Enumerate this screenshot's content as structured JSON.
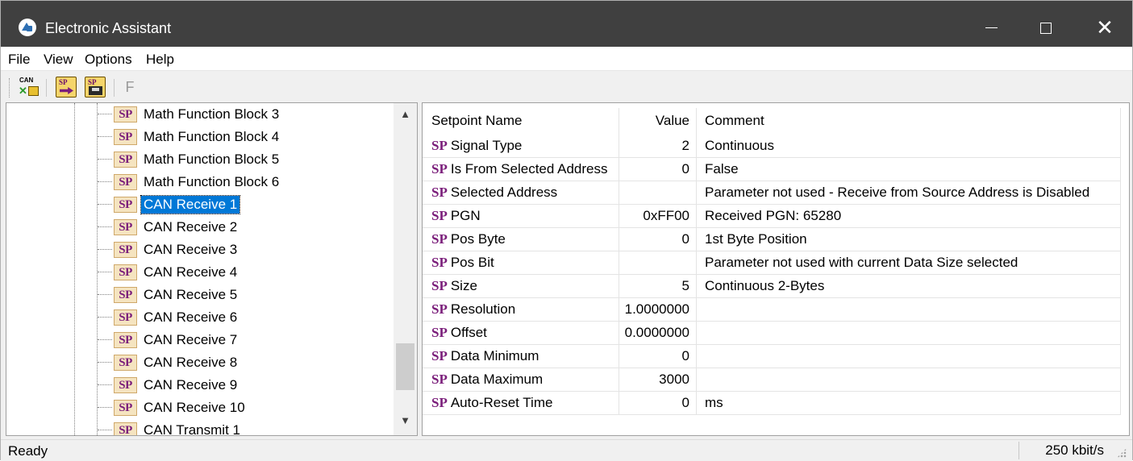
{
  "window": {
    "title": "Electronic Assistant",
    "icon": "electronic-assistant-logo"
  },
  "menu": [
    "File",
    "View",
    "Options",
    "Help"
  ],
  "toolbar": {
    "can_label": "CAN",
    "sp_label": "SP",
    "f_label": "F",
    "buttons": [
      "can-connect-icon",
      "open-setpoint-file-icon",
      "save-setpoint-file-icon",
      "flash-icon"
    ]
  },
  "tree": {
    "badge": "SP",
    "items": [
      "Math Function Block 3",
      "Math Function Block 4",
      "Math Function Block 5",
      "Math Function Block 6",
      "CAN Receive 1",
      "CAN Receive 2",
      "CAN Receive 3",
      "CAN Receive 4",
      "CAN Receive 5",
      "CAN Receive 6",
      "CAN Receive 7",
      "CAN Receive 8",
      "CAN Receive 9",
      "CAN Receive 10",
      "CAN Transmit 1"
    ],
    "selected": "CAN Receive 1"
  },
  "grid": {
    "headers": {
      "name": "Setpoint Name",
      "value": "Value",
      "comment": "Comment"
    },
    "tag": "SP",
    "rows": [
      {
        "name": "Signal Type",
        "value": "2",
        "comment": "Continuous"
      },
      {
        "name": "Is From Selected Address",
        "value": "0",
        "comment": "False"
      },
      {
        "name": "Selected Address",
        "value": "",
        "comment": "Parameter not used - Receive from Source Address is Disabled"
      },
      {
        "name": "PGN",
        "value": "0xFF00",
        "comment": "Received PGN: 65280"
      },
      {
        "name": "Pos Byte",
        "value": "0",
        "comment": "1st Byte Position"
      },
      {
        "name": "Pos Bit",
        "value": "",
        "comment": "Parameter not used with current Data Size selected"
      },
      {
        "name": "Size",
        "value": "5",
        "comment": "Continuous 2-Bytes"
      },
      {
        "name": "Resolution",
        "value": "1.0000000",
        "comment": ""
      },
      {
        "name": "Offset",
        "value": "0.0000000",
        "comment": ""
      },
      {
        "name": "Data Minimum",
        "value": "0",
        "comment": ""
      },
      {
        "name": "Data Maximum",
        "value": "3000",
        "comment": ""
      },
      {
        "name": "Auto-Reset Time",
        "value": "0",
        "comment": "ms"
      }
    ]
  },
  "status": {
    "text": "Ready",
    "baud": "250 kbit/s"
  }
}
